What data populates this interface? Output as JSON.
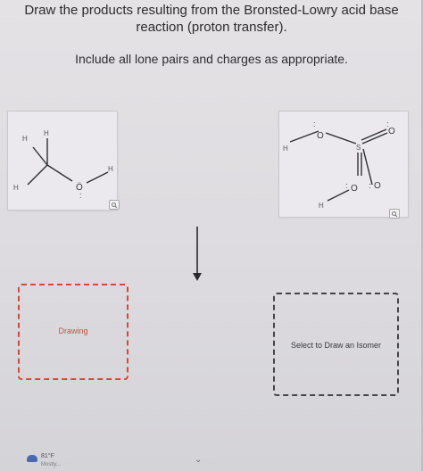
{
  "question": {
    "title": "Draw the products resulting from the Bronsted-Lowry acid base reaction (proton transfer).",
    "instruction": "Include all lone pairs and charges as appropriate."
  },
  "reactant_left": {
    "atoms": [
      "H",
      "H",
      "H",
      "H",
      "Ö"
    ],
    "lone_pairs": ":"
  },
  "reactant_right": {
    "atoms": [
      "H",
      "O",
      "S",
      "O",
      "O",
      "O",
      "H"
    ],
    "lone_pairs": ":"
  },
  "icons": {
    "zoom": "magnifier-icon",
    "arrow": "reaction-arrow-down-icon",
    "chevron": "chevron-down-icon",
    "weather": "weather-icon"
  },
  "product_left": {
    "label": "Drawing"
  },
  "product_right": {
    "label": "Select to Draw an Isomer"
  },
  "taskbar": {
    "temp": "81°F",
    "condition": "Mostly..."
  },
  "colors": {
    "drawing_border": "#d24a3c",
    "isomer_border": "#44444a"
  }
}
